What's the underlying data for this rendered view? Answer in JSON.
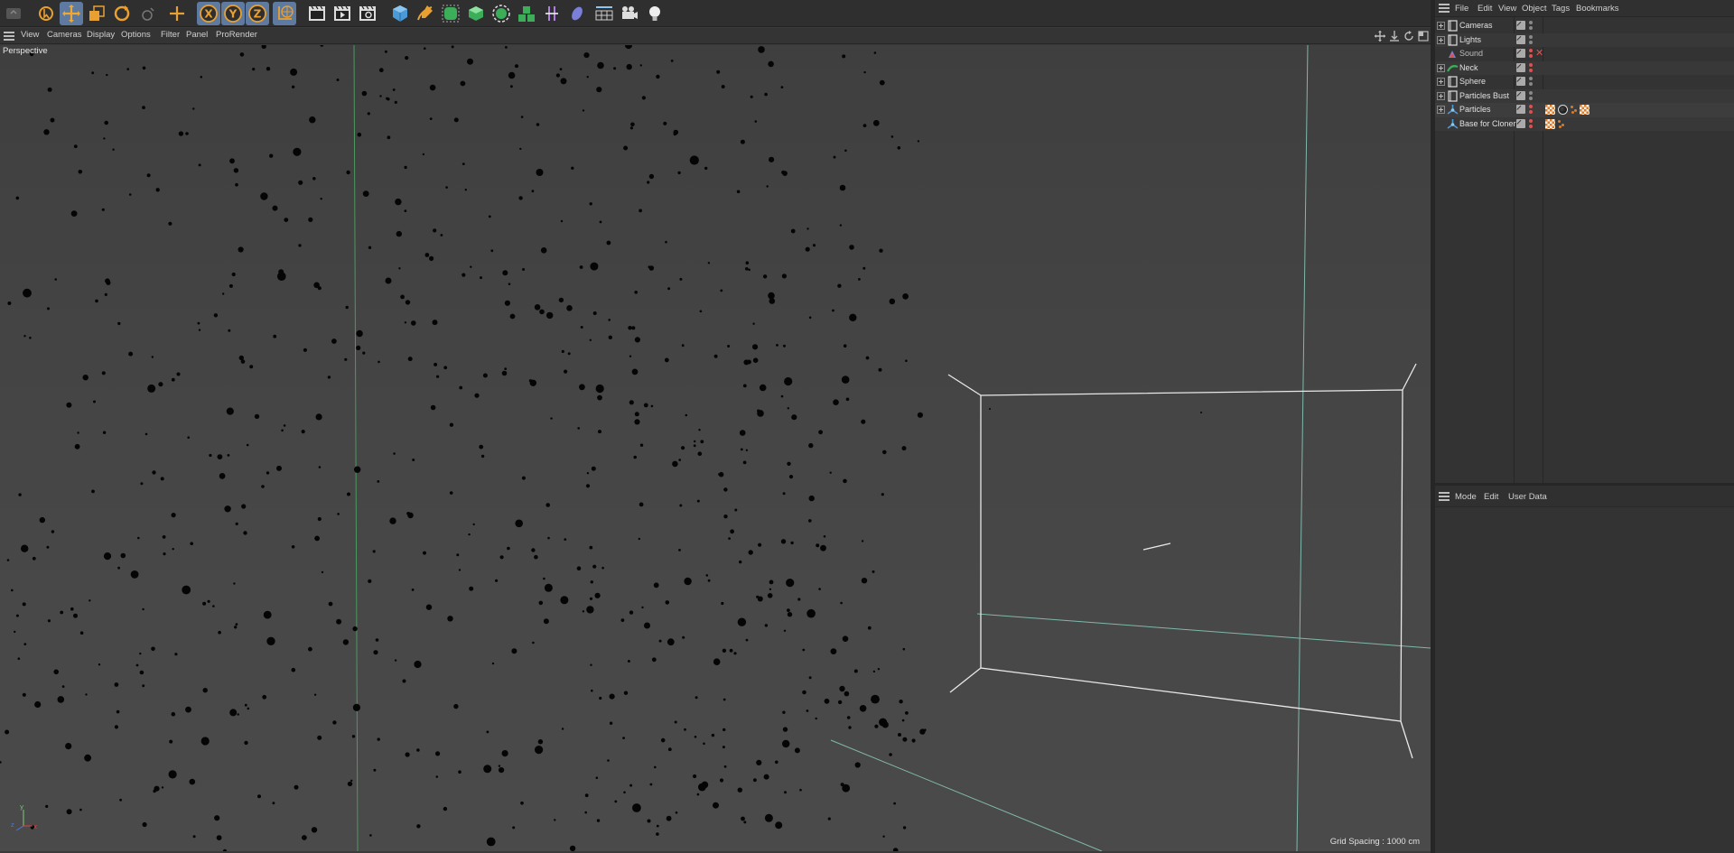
{
  "viewport_menu": {
    "items": [
      "View",
      "Cameras",
      "Display",
      "Options",
      "Filter",
      "Panel",
      "ProRender"
    ]
  },
  "viewport": {
    "label": "Perspective",
    "grid_spacing": "Grid Spacing : 1000 cm"
  },
  "object_manager": {
    "menu": [
      "File",
      "Edit",
      "View",
      "Object",
      "Tags",
      "Bookmarks"
    ],
    "objects": [
      {
        "name": "Cameras",
        "icon": "null-object-icon",
        "expandable": true
      },
      {
        "name": "Lights",
        "icon": "null-object-icon",
        "expandable": true
      },
      {
        "name": "Sound",
        "icon": "sound-icon",
        "expandable": false,
        "disabled": true
      },
      {
        "name": "Neck",
        "icon": "spline-icon",
        "expandable": true
      },
      {
        "name": "Sphere",
        "icon": "null-object-icon",
        "expandable": true
      },
      {
        "name": "Particles Bust",
        "icon": "null-object-icon",
        "expandable": true
      },
      {
        "name": "Particles",
        "icon": "cloner-icon",
        "expandable": true,
        "tags": [
          "checker-material-tag",
          "sphere-material-tag",
          "dots-tag",
          "checker-material-tag"
        ]
      },
      {
        "name": "Base for Cloner",
        "icon": "cloner-icon",
        "expandable": false,
        "tags": [
          "checker-material-tag",
          "dots-tag"
        ]
      }
    ]
  },
  "attribute_manager": {
    "menu": [
      "Mode",
      "Edit",
      "User Data"
    ]
  },
  "colors": {
    "accent_orange": "#e8a030",
    "selected_blue": "#5e7aa0",
    "grid_green": "#4a9a60",
    "wire_white": "#e8e8e8"
  }
}
